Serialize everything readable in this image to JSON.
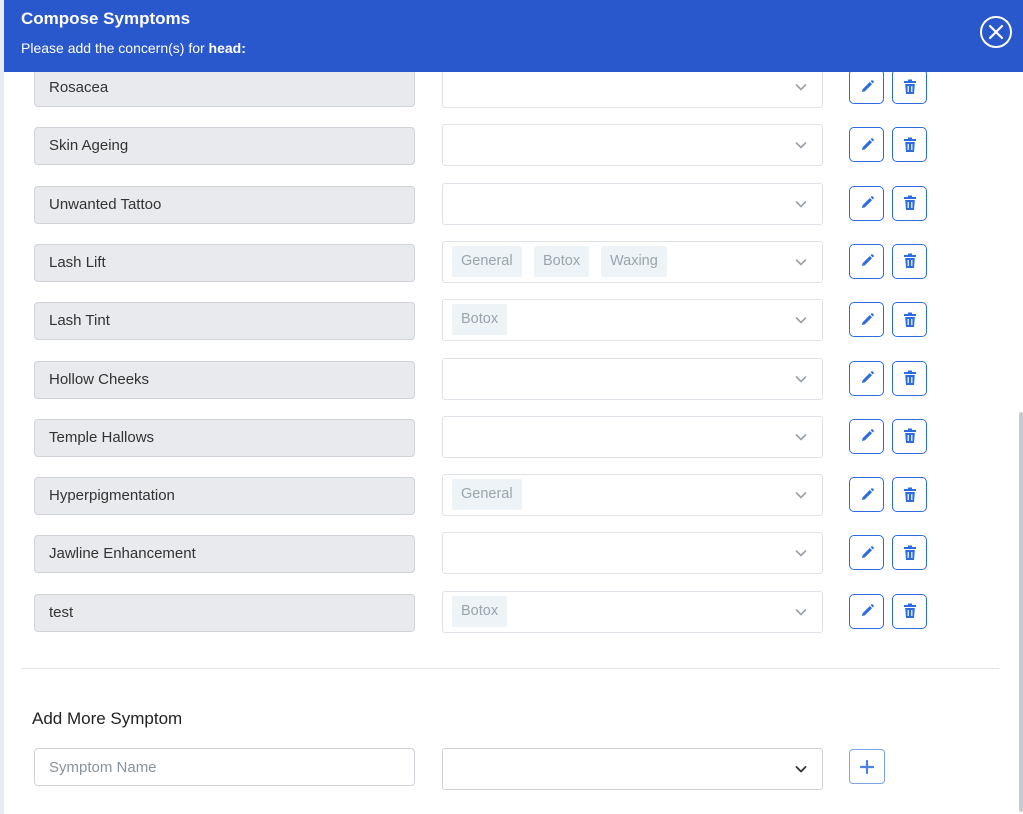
{
  "header": {
    "title": "Compose Symptoms",
    "subtitle_prefix": "Please add the concern(s) for ",
    "subtitle_target": "head:"
  },
  "symptoms": [
    {
      "name": "Rosacea",
      "tags": []
    },
    {
      "name": "Skin Ageing",
      "tags": []
    },
    {
      "name": "Unwanted Tattoo",
      "tags": []
    },
    {
      "name": "Lash Lift",
      "tags": [
        "General",
        "Botox",
        "Waxing"
      ]
    },
    {
      "name": "Lash Tint",
      "tags": [
        "Botox"
      ]
    },
    {
      "name": "Hollow Cheeks",
      "tags": []
    },
    {
      "name": "Temple Hallows",
      "tags": []
    },
    {
      "name": "Hyperpigmentation",
      "tags": [
        "General"
      ]
    },
    {
      "name": "Jawline Enhancement",
      "tags": []
    },
    {
      "name": "test",
      "tags": [
        "Botox"
      ]
    }
  ],
  "add_section": {
    "title": "Add More Symptom",
    "name_placeholder": "Symptom Name"
  },
  "icons": {
    "close": "close-icon",
    "edit": "pencil-icon",
    "delete": "trash-icon",
    "chevron": "chevron-down-icon",
    "add": "plus-icon"
  },
  "colors": {
    "header_bg": "#2957cc",
    "accent": "#2c6ce0",
    "tag_bg": "#eef3f8",
    "tag_text": "#9aa4ae",
    "name_box_bg": "#e8eaed"
  }
}
